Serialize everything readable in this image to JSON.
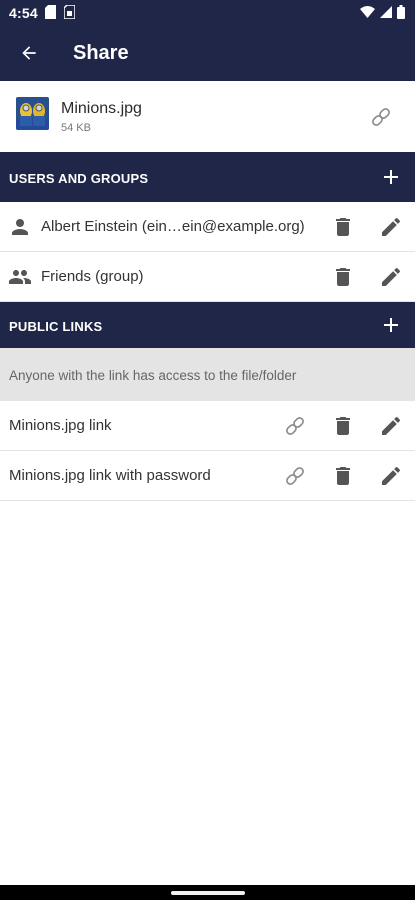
{
  "status_bar": {
    "time": "4:54"
  },
  "toolbar": {
    "title": "Share",
    "back_icon": "arrow-back-icon"
  },
  "file": {
    "name": "Minions.jpg",
    "size": "54 KB"
  },
  "users_and_groups": {
    "title": "USERS AND GROUPS",
    "items": [
      {
        "label": "Albert Einstein (ein…ein@example.org)",
        "icon": "person-icon"
      },
      {
        "label": "Friends (group)",
        "icon": "group-icon"
      }
    ]
  },
  "public_links": {
    "title": "PUBLIC LINKS",
    "info": "Anyone with the link has access to the file/folder",
    "items": [
      {
        "label": "Minions.jpg link"
      },
      {
        "label": "Minions.jpg link with password"
      }
    ]
  },
  "colors": {
    "primary": "#1f2647",
    "icon_gray": "#555555",
    "info_bg": "#e4e4e4"
  }
}
